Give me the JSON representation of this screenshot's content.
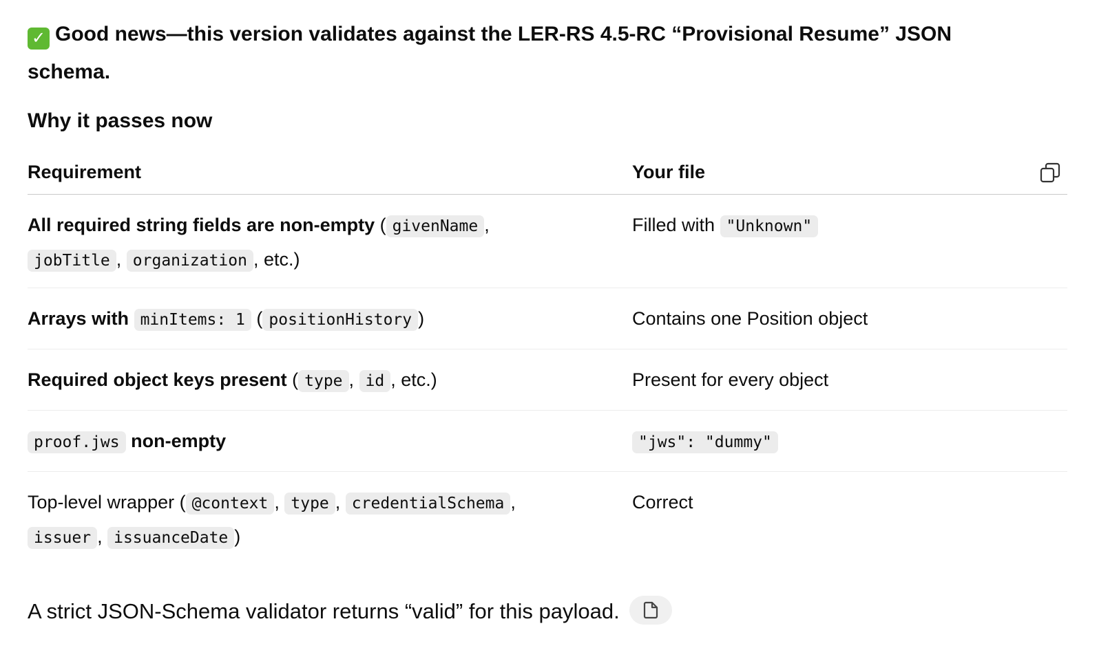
{
  "headline": {
    "icon": "check-mark-button-icon",
    "text": "Good news—this version validates against the LER-RS 4.5-RC “Provisional Resume” JSON schema."
  },
  "subheading": "Why it passes now",
  "table": {
    "headers": [
      "Requirement",
      "Your file"
    ],
    "rows": [
      {
        "req_bold": "All required string fields are non-empty",
        "req_open": " (",
        "codes": [
          "givenName",
          "jobTitle",
          "organization"
        ],
        "req_close": ", etc.)",
        "file_text": "Filled with ",
        "file_code": "\"Unknown\""
      },
      {
        "req_bold": "Arrays with",
        "code_inline": "minItems: 1",
        "req_open": " (",
        "codes": [
          "positionHistory"
        ],
        "req_close": ")",
        "file_text": "Contains one Position object"
      },
      {
        "req_bold": "Required object keys present",
        "req_open": " (",
        "codes": [
          "type",
          "id"
        ],
        "req_close": ", etc.)",
        "file_text": "Present for every object"
      },
      {
        "code_first": "proof.jws",
        "req_bold": "non-empty",
        "file_code": "\"jws\": \"dummy\""
      },
      {
        "req_text": "Top-level wrapper (",
        "codes": [
          "@context",
          "type",
          "credentialSchema",
          "issuer",
          "issuanceDate"
        ],
        "req_close": ")",
        "file_text": "Correct"
      }
    ]
  },
  "footer": {
    "text": "A strict JSON-Schema validator returns “valid” for this payload."
  }
}
